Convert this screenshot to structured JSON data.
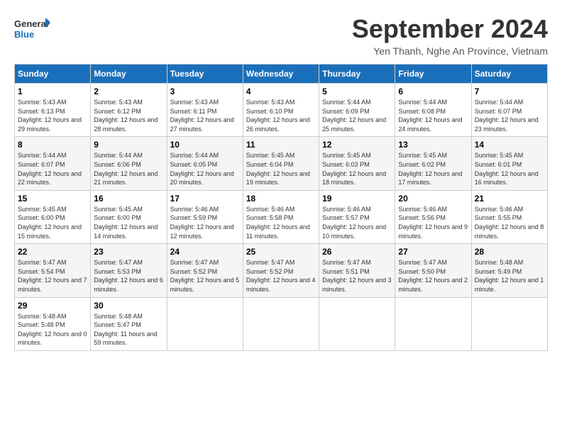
{
  "header": {
    "logo_line1": "General",
    "logo_line2": "Blue",
    "month": "September 2024",
    "location": "Yen Thanh, Nghe An Province, Vietnam"
  },
  "days_of_week": [
    "Sunday",
    "Monday",
    "Tuesday",
    "Wednesday",
    "Thursday",
    "Friday",
    "Saturday"
  ],
  "weeks": [
    [
      {
        "day": "1",
        "sunrise": "5:43 AM",
        "sunset": "6:13 PM",
        "daylight": "12 hours and 29 minutes."
      },
      {
        "day": "2",
        "sunrise": "5:43 AM",
        "sunset": "6:12 PM",
        "daylight": "12 hours and 28 minutes."
      },
      {
        "day": "3",
        "sunrise": "5:43 AM",
        "sunset": "6:11 PM",
        "daylight": "12 hours and 27 minutes."
      },
      {
        "day": "4",
        "sunrise": "5:43 AM",
        "sunset": "6:10 PM",
        "daylight": "12 hours and 26 minutes."
      },
      {
        "day": "5",
        "sunrise": "5:44 AM",
        "sunset": "6:09 PM",
        "daylight": "12 hours and 25 minutes."
      },
      {
        "day": "6",
        "sunrise": "5:44 AM",
        "sunset": "6:08 PM",
        "daylight": "12 hours and 24 minutes."
      },
      {
        "day": "7",
        "sunrise": "5:44 AM",
        "sunset": "6:07 PM",
        "daylight": "12 hours and 23 minutes."
      }
    ],
    [
      {
        "day": "8",
        "sunrise": "5:44 AM",
        "sunset": "6:07 PM",
        "daylight": "12 hours and 22 minutes."
      },
      {
        "day": "9",
        "sunrise": "5:44 AM",
        "sunset": "6:06 PM",
        "daylight": "12 hours and 21 minutes."
      },
      {
        "day": "10",
        "sunrise": "5:44 AM",
        "sunset": "6:05 PM",
        "daylight": "12 hours and 20 minutes."
      },
      {
        "day": "11",
        "sunrise": "5:45 AM",
        "sunset": "6:04 PM",
        "daylight": "12 hours and 19 minutes."
      },
      {
        "day": "12",
        "sunrise": "5:45 AM",
        "sunset": "6:03 PM",
        "daylight": "12 hours and 18 minutes."
      },
      {
        "day": "13",
        "sunrise": "5:45 AM",
        "sunset": "6:02 PM",
        "daylight": "12 hours and 17 minutes."
      },
      {
        "day": "14",
        "sunrise": "5:45 AM",
        "sunset": "6:01 PM",
        "daylight": "12 hours and 16 minutes."
      }
    ],
    [
      {
        "day": "15",
        "sunrise": "5:45 AM",
        "sunset": "6:00 PM",
        "daylight": "12 hours and 15 minutes."
      },
      {
        "day": "16",
        "sunrise": "5:45 AM",
        "sunset": "6:00 PM",
        "daylight": "12 hours and 14 minutes."
      },
      {
        "day": "17",
        "sunrise": "5:46 AM",
        "sunset": "5:59 PM",
        "daylight": "12 hours and 12 minutes."
      },
      {
        "day": "18",
        "sunrise": "5:46 AM",
        "sunset": "5:58 PM",
        "daylight": "12 hours and 11 minutes."
      },
      {
        "day": "19",
        "sunrise": "5:46 AM",
        "sunset": "5:57 PM",
        "daylight": "12 hours and 10 minutes."
      },
      {
        "day": "20",
        "sunrise": "5:46 AM",
        "sunset": "5:56 PM",
        "daylight": "12 hours and 9 minutes."
      },
      {
        "day": "21",
        "sunrise": "5:46 AM",
        "sunset": "5:55 PM",
        "daylight": "12 hours and 8 minutes."
      }
    ],
    [
      {
        "day": "22",
        "sunrise": "5:47 AM",
        "sunset": "5:54 PM",
        "daylight": "12 hours and 7 minutes."
      },
      {
        "day": "23",
        "sunrise": "5:47 AM",
        "sunset": "5:53 PM",
        "daylight": "12 hours and 6 minutes."
      },
      {
        "day": "24",
        "sunrise": "5:47 AM",
        "sunset": "5:52 PM",
        "daylight": "12 hours and 5 minutes."
      },
      {
        "day": "25",
        "sunrise": "5:47 AM",
        "sunset": "5:52 PM",
        "daylight": "12 hours and 4 minutes."
      },
      {
        "day": "26",
        "sunrise": "5:47 AM",
        "sunset": "5:51 PM",
        "daylight": "12 hours and 3 minutes."
      },
      {
        "day": "27",
        "sunrise": "5:47 AM",
        "sunset": "5:50 PM",
        "daylight": "12 hours and 2 minutes."
      },
      {
        "day": "28",
        "sunrise": "5:48 AM",
        "sunset": "5:49 PM",
        "daylight": "12 hours and 1 minute."
      }
    ],
    [
      {
        "day": "29",
        "sunrise": "5:48 AM",
        "sunset": "5:48 PM",
        "daylight": "12 hours and 0 minutes."
      },
      {
        "day": "30",
        "sunrise": "5:48 AM",
        "sunset": "5:47 PM",
        "daylight": "11 hours and 59 minutes."
      },
      null,
      null,
      null,
      null,
      null
    ]
  ]
}
